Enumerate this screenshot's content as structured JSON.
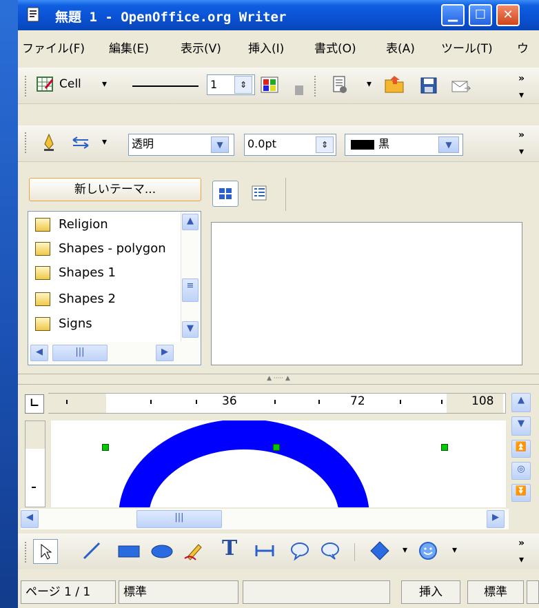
{
  "window": {
    "title": "無題 1 - OpenOffice.org Writer",
    "title_prefix_icon": "document-app-icon",
    "buttons": [
      "minimize",
      "maximize",
      "close"
    ]
  },
  "menubar": [
    "ファイル(F)",
    "編集(E)",
    "表示(V)",
    "挿入(I)",
    "書式(O)",
    "表(A)",
    "ツール(T)",
    "ウ"
  ],
  "toolbar1": {
    "cell_label": "Cell",
    "line_width": "1",
    "overflow": "»"
  },
  "toolbar2": {
    "fill_value": "透明",
    "size_value": "0.0pt",
    "color_value": "黒",
    "color_swatch": "#000000",
    "overflow": "»"
  },
  "gallery": {
    "new_theme_label": "新しいテーマ...",
    "themes": [
      "Religion",
      "Shapes - polygon",
      "Shapes 1",
      "Shapes 2",
      "Signs"
    ]
  },
  "ruler": {
    "ticks": [
      "36",
      "72",
      "108"
    ]
  },
  "document": {
    "shape_color": "#0000ff",
    "handle_color": "#00c800"
  },
  "statusbar": {
    "page": "ページ 1 / 1",
    "style": "標準",
    "mode": "挿入",
    "selection": "標準"
  }
}
